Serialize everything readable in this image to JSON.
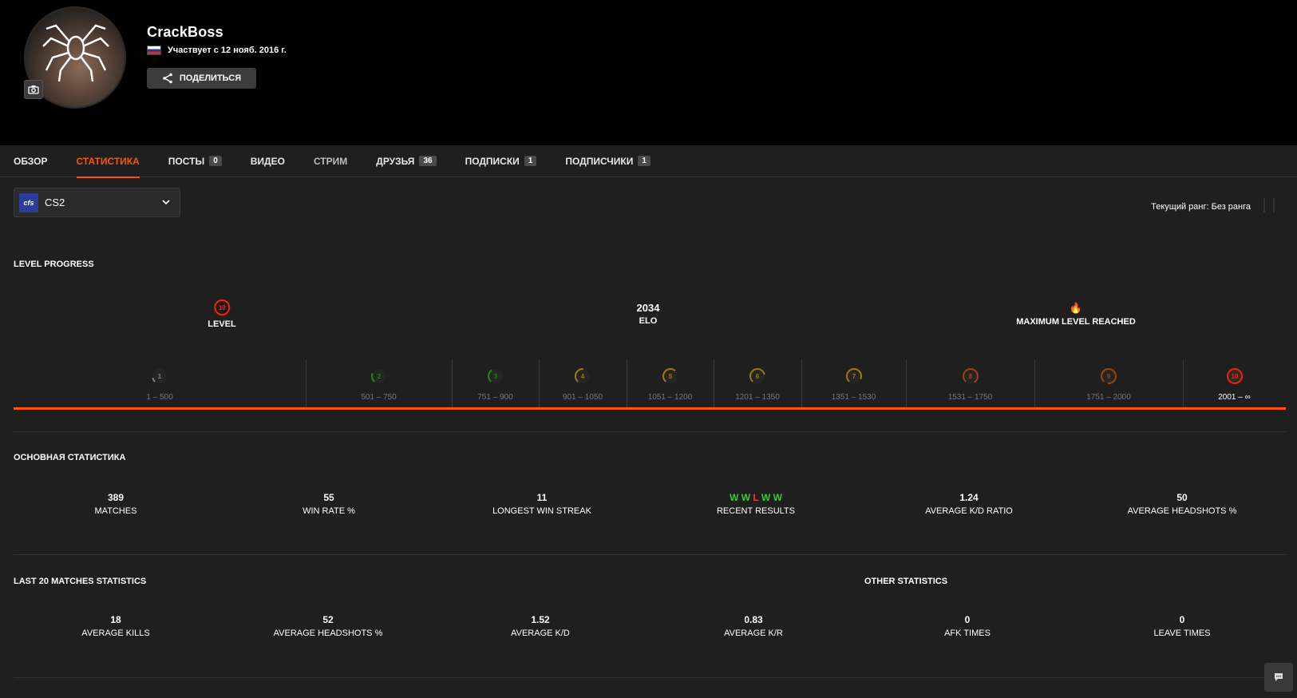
{
  "profile": {
    "username": "CrackBoss",
    "member_since": "Участвует с 12 нояб. 2016 г.",
    "share_label": "Поделиться"
  },
  "tabs": [
    {
      "label": "Обзор"
    },
    {
      "label": "Статистика"
    },
    {
      "label": "Посты",
      "badge": "0"
    },
    {
      "label": "Видео"
    },
    {
      "label": "Стрим"
    },
    {
      "label": "Друзья",
      "badge": "36"
    },
    {
      "label": "Подписки",
      "badge": "1"
    },
    {
      "label": "Подписчики",
      "badge": "1"
    }
  ],
  "game_select": {
    "logo": "cfs",
    "name": "CS2"
  },
  "rank_label": "Текущий ранг: Без ранга",
  "level_progress": {
    "title": "LEVEL PROGRESS",
    "level_value": "10",
    "level_label": "LEVEL",
    "elo_value": "2034",
    "elo_label": "ELO",
    "max_label": "MAXIMUM LEVEL REACHED",
    "levels": [
      {
        "n": "1",
        "range": "1 – 500",
        "color": "#cccccc"
      },
      {
        "n": "2",
        "range": "501 – 750",
        "color": "#1ce400"
      },
      {
        "n": "3",
        "range": "751 – 900",
        "color": "#1ce400"
      },
      {
        "n": "4",
        "range": "901 – 1050",
        "color": "#ffc800"
      },
      {
        "n": "5",
        "range": "1051 – 1200",
        "color": "#ffc800"
      },
      {
        "n": "6",
        "range": "1201 – 1350",
        "color": "#ffc800"
      },
      {
        "n": "7",
        "range": "1351 – 1530",
        "color": "#ffc800"
      },
      {
        "n": "8",
        "range": "1531 – 1750",
        "color": "#ff6309"
      },
      {
        "n": "9",
        "range": "1751 – 2000",
        "color": "#ff6309"
      },
      {
        "n": "10",
        "range": "2001 – ∞",
        "color": "#fe1f00"
      }
    ]
  },
  "main_stats": {
    "title": "ОСНОВНАЯ СТАТИСТИКА",
    "items": [
      {
        "value": "389",
        "label": "MATCHES"
      },
      {
        "value": "55",
        "label": "WIN RATE %"
      },
      {
        "value": "11",
        "label": "LONGEST WIN STREAK"
      },
      {
        "value": "W W L W W",
        "label": "RECENT RESULTS"
      },
      {
        "value": "1.24",
        "label": "AVERAGE K/D RATIO"
      },
      {
        "value": "50",
        "label": "AVERAGE HEADSHOTS %"
      }
    ],
    "recent": [
      "W",
      "W",
      "L",
      "W",
      "W"
    ]
  },
  "last20": {
    "title": "LAST 20 MATCHES STATISTICS",
    "items": [
      {
        "value": "18",
        "label": "AVERAGE KILLS"
      },
      {
        "value": "52",
        "label": "AVERAGE HEADSHOTS %"
      },
      {
        "value": "1.52",
        "label": "AVERAGE K/D"
      },
      {
        "value": "0.83",
        "label": "AVERAGE K/R"
      }
    ]
  },
  "other": {
    "title": "OTHER STATISTICS",
    "items": [
      {
        "value": "0",
        "label": "AFK TIMES"
      },
      {
        "value": "0",
        "label": "LEAVE TIMES"
      }
    ]
  },
  "colors": {
    "accent": "#ff5500",
    "win": "#33cc33",
    "loss": "#ff3333"
  }
}
